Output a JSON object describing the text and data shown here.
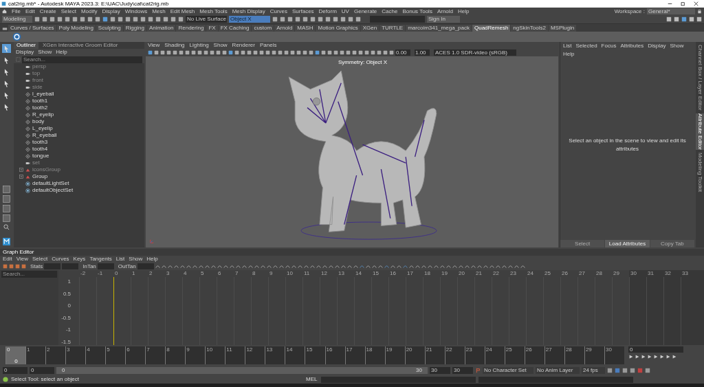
{
  "window": {
    "title": "cat2rig.mb* - Autodesk MAYA 2023.3: E:\\UAC\\Judy\\cat\\cat2rig.mb"
  },
  "menu_bar": [
    "File",
    "Edit",
    "Create",
    "Select",
    "Modify",
    "Display",
    "Windows",
    "Mesh",
    "Edit Mesh",
    "Mesh Tools",
    "Mesh Display",
    "Curves",
    "Surfaces",
    "Deform",
    "UV",
    "Generate",
    "Cache",
    "Bonus Tools",
    "Arnold",
    "Help"
  ],
  "workspace": {
    "label": "Workspace :",
    "value": "General*"
  },
  "status_line": {
    "mode": "Modeling",
    "live_surface": "No Live Surface",
    "symmetry": "Object X",
    "sign_in": "Sign In"
  },
  "shelf_tabs": [
    {
      "label": "Curves / Surfaces",
      "selected": false
    },
    {
      "label": "Poly Modeling",
      "selected": false
    },
    {
      "label": "Sculpting",
      "selected": false
    },
    {
      "label": "Rigging",
      "selected": false
    },
    {
      "label": "Animation",
      "selected": false
    },
    {
      "label": "Rendering",
      "selected": false
    },
    {
      "label": "FX",
      "selected": false
    },
    {
      "label": "FX Caching",
      "selected": false
    },
    {
      "label": "custom",
      "selected": false
    },
    {
      "label": "Arnold",
      "selected": false
    },
    {
      "label": "MASH",
      "selected": false
    },
    {
      "label": "Motion Graphics",
      "selected": false
    },
    {
      "label": "XGen",
      "selected": false
    },
    {
      "label": "TURTLE",
      "selected": false
    },
    {
      "label": "marcoim341_mega_pack",
      "selected": false
    },
    {
      "label": "QuadRemesh",
      "selected": true
    },
    {
      "label": "ngSkinTools2",
      "selected": false
    },
    {
      "label": "MSPlugin",
      "selected": false
    }
  ],
  "outliner": {
    "tabs": [
      {
        "label": "Outliner",
        "selected": true
      },
      {
        "label": "XGen Interactive Groom Editor",
        "selected": false
      }
    ],
    "menus": [
      "Display",
      "Show",
      "Help"
    ],
    "search": {
      "placeholder": "Search..."
    },
    "items": [
      {
        "name": "persp",
        "kind": "camera",
        "dimmed": true,
        "expandable": false
      },
      {
        "name": "top",
        "kind": "camera",
        "dimmed": true,
        "expandable": false
      },
      {
        "name": "front",
        "kind": "camera",
        "dimmed": true,
        "expandable": false
      },
      {
        "name": "side",
        "kind": "camera",
        "dimmed": true,
        "expandable": false
      },
      {
        "name": "l_eyeball",
        "kind": "mesh",
        "dimmed": false,
        "expandable": false
      },
      {
        "name": "tooth1",
        "kind": "mesh",
        "dimmed": false,
        "expandable": false
      },
      {
        "name": "tooth2",
        "kind": "mesh",
        "dimmed": false,
        "expandable": false
      },
      {
        "name": "R_eyelip",
        "kind": "mesh",
        "dimmed": false,
        "expandable": false
      },
      {
        "name": "body",
        "kind": "mesh",
        "dimmed": false,
        "expandable": false
      },
      {
        "name": "L_eyelip",
        "kind": "mesh",
        "dimmed": false,
        "expandable": false
      },
      {
        "name": "R_eyeball",
        "kind": "mesh",
        "dimmed": false,
        "expandable": false
      },
      {
        "name": "tooth3",
        "kind": "mesh",
        "dimmed": false,
        "expandable": false
      },
      {
        "name": "tooth4",
        "kind": "mesh",
        "dimmed": false,
        "expandable": false
      },
      {
        "name": "tongue",
        "kind": "mesh",
        "dimmed": false,
        "expandable": false
      },
      {
        "name": "set",
        "kind": "camera",
        "dimmed": true,
        "expandable": false
      },
      {
        "name": "iconsGroup",
        "kind": "group",
        "dimmed": true,
        "expandable": true
      },
      {
        "name": "Group",
        "kind": "group",
        "dimmed": false,
        "expandable": true
      },
      {
        "name": "defaultLightSet",
        "kind": "set",
        "dimmed": false,
        "expandable": false
      },
      {
        "name": "defaultObjectSet",
        "kind": "set",
        "dimmed": false,
        "expandable": false
      }
    ]
  },
  "viewport": {
    "menus": [
      "View",
      "Shading",
      "Lighting",
      "Show",
      "Renderer",
      "Panels"
    ],
    "exposure": "0.00",
    "gamma": "1.00",
    "color_space": "ACES 1.0 SDR-video (sRGB)",
    "overlay": "Symmetry: Object X"
  },
  "attribute_editor": {
    "menus": [
      "List",
      "Selected",
      "Focus",
      "Attributes",
      "Display",
      "Show",
      "Help"
    ],
    "message": "Select an object in the scene to view and edit its attributes",
    "buttons": [
      "Select",
      "Load Attributes",
      "Copy Tab"
    ],
    "side_tabs": [
      {
        "label": "Channel Box / Layer Editor",
        "selected": false
      },
      {
        "label": "Attribute Editor",
        "selected": true
      },
      {
        "label": "Modeling Toolkit",
        "selected": false
      }
    ]
  },
  "graph_editor": {
    "title": "Graph Editor",
    "menus": [
      "Edit",
      "View",
      "Select",
      "Curves",
      "Keys",
      "Tangents",
      "List",
      "Show",
      "Help"
    ],
    "stats_label": "Stats",
    "in_tangent_label": "InTan",
    "out_tangent_label": "OutTan",
    "search": {
      "placeholder": "Search..."
    },
    "ruler": [
      "-2",
      "-1",
      "0",
      "1",
      "2",
      "3",
      "4",
      "5",
      "6",
      "7",
      "8",
      "9",
      "10",
      "11",
      "12",
      "13",
      "14",
      "15",
      "16",
      "17",
      "18",
      "19",
      "20",
      "21",
      "22",
      "23",
      "24",
      "25",
      "26",
      "27",
      "28",
      "29",
      "30",
      "31",
      "32",
      "33"
    ],
    "y_labels": [
      "1",
      "0.5",
      "0",
      "-0.5",
      "-1",
      "-1.5"
    ]
  },
  "time_slider": {
    "frames": [
      {
        "label": "0",
        "selected": true
      },
      {
        "label": "1",
        "selected": false
      },
      {
        "label": "2",
        "selected": false
      },
      {
        "label": "3",
        "selected": false
      },
      {
        "label": "4",
        "selected": false
      },
      {
        "label": "5",
        "selected": false
      },
      {
        "label": "6",
        "selected": false
      },
      {
        "label": "7",
        "selected": false
      },
      {
        "label": "8",
        "selected": false
      },
      {
        "label": "9",
        "selected": false
      },
      {
        "label": "10",
        "selected": false
      },
      {
        "label": "11",
        "selected": false
      },
      {
        "label": "12",
        "selected": false
      },
      {
        "label": "13",
        "selected": false
      },
      {
        "label": "14",
        "selected": false
      },
      {
        "label": "15",
        "selected": false
      },
      {
        "label": "16",
        "selected": false
      },
      {
        "label": "17",
        "selected": false
      },
      {
        "label": "18",
        "selected": false
      },
      {
        "label": "19",
        "selected": false
      },
      {
        "label": "20",
        "selected": false
      },
      {
        "label": "21",
        "selected": false
      },
      {
        "label": "22",
        "selected": false
      },
      {
        "label": "23",
        "selected": false
      },
      {
        "label": "24",
        "selected": false
      },
      {
        "label": "25",
        "selected": false
      },
      {
        "label": "26",
        "selected": false
      },
      {
        "label": "27",
        "selected": false
      },
      {
        "label": "28",
        "selected": false
      },
      {
        "label": "29",
        "selected": false
      },
      {
        "label": "30",
        "selected": false
      }
    ],
    "current": "0",
    "frame_field": "0"
  },
  "range_slider": {
    "level": 1,
    "start": "0",
    "playback_start": "0",
    "slider_start": "0",
    "slider_end": "30",
    "playback_end": "30",
    "end": "30",
    "character_set": "No Character Set",
    "anim_layer": "No Anim Layer",
    "fps": "24 fps"
  },
  "help_line": {
    "message": "Select Tool: select an object",
    "command_language": "MEL"
  }
}
